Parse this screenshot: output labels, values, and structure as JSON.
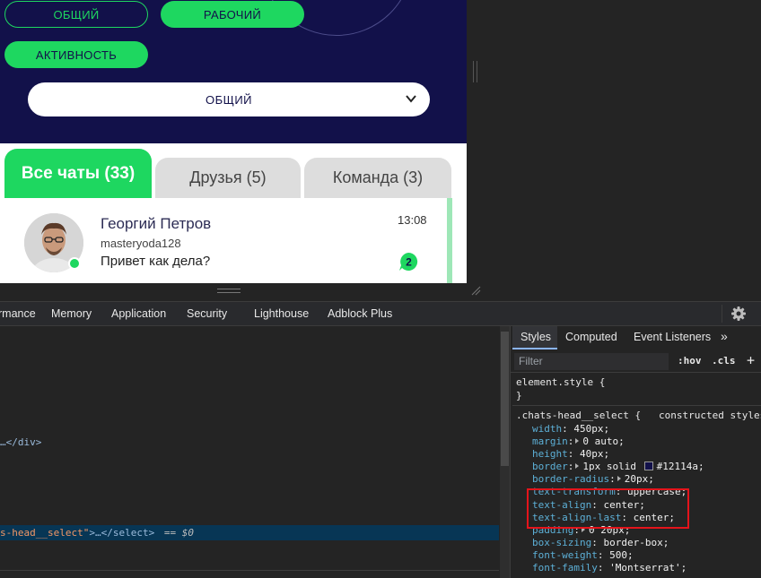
{
  "viewport": {
    "hero": {
      "buttons": [
        {
          "label": "ОБЩИЙ",
          "style": "outline"
        },
        {
          "label": "РАБОЧИЙ",
          "style": "filled"
        },
        {
          "label": "АКТИВНОСТЬ",
          "style": "filled"
        }
      ],
      "select_value": "ОБЩИЙ"
    },
    "tabs": [
      {
        "label": "Все чаты (33)",
        "active": true
      },
      {
        "label": "Друзья (5)",
        "active": false
      },
      {
        "label": "Команда (3)",
        "active": false
      }
    ],
    "chat": {
      "name": "Георгий Петров",
      "username": "masteryoda128",
      "message": "Привет как дела?",
      "time": "13:08",
      "unread": "2"
    }
  },
  "devtools": {
    "tabs": [
      "rmance",
      "Memory",
      "Application",
      "Security",
      "Lighthouse",
      "Adblock Plus"
    ],
    "elements": {
      "line_div": "…</div>",
      "selected_line": {
        "class_part": "s-head__select\"",
        "rest": ">…</select>",
        "suffix": "== $0"
      }
    },
    "styles_panel": {
      "tabs": [
        "Styles",
        "Computed",
        "Event Listeners",
        "»"
      ],
      "filter_placeholder": "Filter",
      "buttons": [
        ":hov",
        ".cls",
        "+"
      ],
      "element_style": {
        "selector": "element.style {",
        "close": "}"
      },
      "rule": {
        "selector": ".chats-head__select {",
        "source": "constructed styles",
        "props": [
          {
            "name": "width",
            "value": "450px;"
          },
          {
            "name": "margin",
            "value": "0 auto;",
            "expand": true
          },
          {
            "name": "height",
            "value": "40px;"
          },
          {
            "name": "border",
            "value": "1px solid",
            "expand": true,
            "color_value": "#12114a;"
          },
          {
            "name": "border-radius",
            "value": "20px;",
            "expand": true
          },
          {
            "name": "text-transform",
            "value": "uppercase;"
          },
          {
            "name": "text-align",
            "value": "center;"
          },
          {
            "name": "text-align-last",
            "value": "center;"
          },
          {
            "name": "padding",
            "value": "0 20px;",
            "expand": true
          },
          {
            "name": "box-sizing",
            "value": "border-box;"
          },
          {
            "name": "font-weight",
            "value": "500;"
          },
          {
            "name": "font-family",
            "value": "'Montserrat';"
          }
        ]
      }
    }
  },
  "colors": {
    "hero_bg": "#12114a",
    "accent_green": "#1ed760",
    "highlight_red": "#e4141b",
    "devtools_bg": "#242424"
  }
}
